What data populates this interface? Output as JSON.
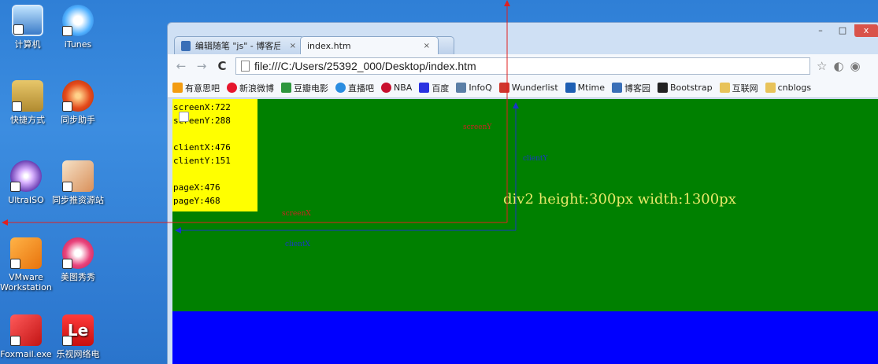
{
  "desktop": {
    "icons": [
      {
        "label": "计算机",
        "icon": "computer-icon"
      },
      {
        "label": "iTunes",
        "icon": "itunes-icon"
      },
      {
        "label": "快捷方式",
        "icon": "shortcut-icon"
      },
      {
        "label": "同步助手",
        "icon": "tongbu-icon"
      },
      {
        "label": "UltraISO",
        "icon": "ultraiso-icon"
      },
      {
        "label": "同步推资源站",
        "icon": "tongbu-resource-icon"
      },
      {
        "label": "VMware Workstation",
        "icon": "vmware-icon"
      },
      {
        "label": "美图秀秀",
        "icon": "meitu-icon"
      },
      {
        "label": "Foxmail.exe",
        "icon": "foxmail-icon"
      },
      {
        "label": "乐视网络电",
        "icon": "letv-icon"
      }
    ]
  },
  "browser": {
    "tabs": [
      {
        "title": "编辑随笔 \"js\" - 博客后台",
        "close": "×"
      },
      {
        "title": "index.htm",
        "close": "×"
      }
    ],
    "window_controls": {
      "minimize": "–",
      "maximize": "□",
      "close": "x"
    },
    "url": "file:///C:/Users/25392_000/Desktop/index.htm",
    "bookmarks": [
      {
        "label": "有意思吧",
        "color": "#f39c12"
      },
      {
        "label": "新浪微博",
        "color": "#e6162d"
      },
      {
        "label": "豆瓣电影",
        "color": "#2e963d"
      },
      {
        "label": "直播吧",
        "color": "#2a8de0"
      },
      {
        "label": "NBA",
        "color": "#c8102e"
      },
      {
        "label": "百度",
        "color": "#2932e1"
      },
      {
        "label": "InfoQ",
        "color": "#5b7fa6"
      },
      {
        "label": "Wunderlist",
        "color": "#d0352c"
      },
      {
        "label": "Mtime",
        "color": "#1e5fb3"
      },
      {
        "label": "博客园",
        "color": "#3a6fb7"
      },
      {
        "label": "Bootstrap",
        "color": "#222222"
      },
      {
        "label": "互联网",
        "color": "#e8c35a"
      },
      {
        "label": "cnblogs",
        "color": "#e8c35a"
      }
    ]
  },
  "page": {
    "info_lines": {
      "screenX": "screenX:722",
      "screenY": "screenY:288",
      "clientX": "clientX:476",
      "clientY": "clientY:151",
      "pageX": "pageX:476",
      "pageY": "pageY:468"
    },
    "div2_label": "div2 height:300px width:1300px",
    "annotations": {
      "screenY": "screenY",
      "clientY": "clientY",
      "screenX": "screenX",
      "clientX": "clientX"
    },
    "colors": {
      "div2": "#008000",
      "info": "#ffff00",
      "background": "#0000ff",
      "screen_lines": "#e02020",
      "client_lines": "#1a35c8"
    }
  }
}
